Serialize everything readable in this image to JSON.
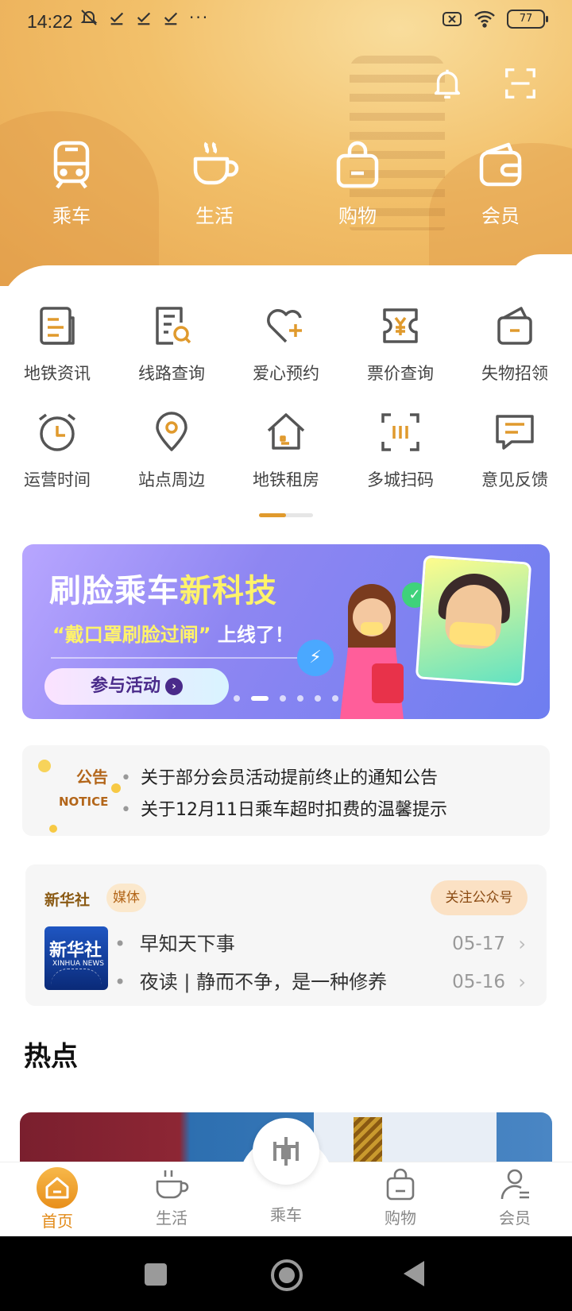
{
  "status_bar": {
    "time": "14:22",
    "battery": "77"
  },
  "header_nav": [
    {
      "label": "乘车",
      "icon": "train-icon"
    },
    {
      "label": "生活",
      "icon": "coffee-cup-icon"
    },
    {
      "label": "购物",
      "icon": "shopping-bag-icon"
    },
    {
      "label": "会员",
      "icon": "wallet-icon"
    }
  ],
  "services": [
    {
      "label": "地铁资讯",
      "icon": "news-doc-icon"
    },
    {
      "label": "线路查询",
      "icon": "route-search-icon"
    },
    {
      "label": "爱心预约",
      "icon": "heart-plus-icon"
    },
    {
      "label": "票价查询",
      "icon": "fare-ticket-icon"
    },
    {
      "label": "失物招领",
      "icon": "lost-bag-icon"
    },
    {
      "label": "运营时间",
      "icon": "alarm-clock-icon"
    },
    {
      "label": "站点周边",
      "icon": "location-pin-icon"
    },
    {
      "label": "地铁租房",
      "icon": "house-icon"
    },
    {
      "label": "多城扫码",
      "icon": "scan-code-icon"
    },
    {
      "label": "意见反馈",
      "icon": "feedback-icon"
    }
  ],
  "banner": {
    "title_a": "刷脸乘车",
    "title_b": "新科技",
    "sub_quote": "“戴口罩刷脸过闸”",
    "sub_rest": "上线了！",
    "button": "参与活动"
  },
  "notice": {
    "badge_cn": "公告",
    "badge_en": "NOTICE",
    "items": [
      "关于部分会员活动提前终止的通知公告",
      "关于12月11日乘车超时扣费的温馨提示"
    ]
  },
  "media": {
    "name": "新华社",
    "tag": "媒体",
    "follow": "关注公众号",
    "logo_cn": "新华社",
    "logo_en": "XINHUA NEWS",
    "articles": [
      {
        "title": "早知天下事",
        "date": "05-17"
      },
      {
        "title": "夜读 | 静而不争，是一种修养",
        "date": "05-16"
      }
    ]
  },
  "hot": {
    "title": "热点"
  },
  "tabbar": {
    "home": "首页",
    "life": "生活",
    "ride": "乘车",
    "shop": "购物",
    "member": "会员"
  },
  "colors": {
    "accent": "#e28a18",
    "header": "#f2c06a"
  }
}
